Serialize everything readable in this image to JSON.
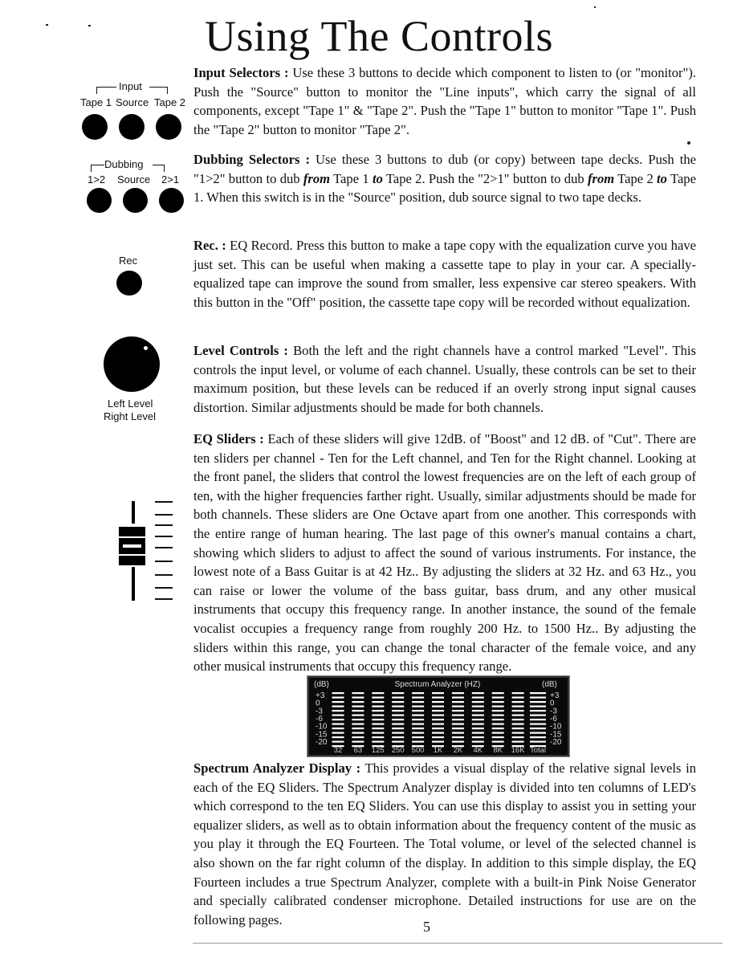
{
  "page": {
    "title": "Using The Controls",
    "page_number": "5"
  },
  "panel": {
    "input": {
      "group_label": "Input",
      "buttons": [
        "Tape 1",
        "Source",
        "Tape 2"
      ]
    },
    "dubbing": {
      "group_label": "Dubbing",
      "buttons": [
        "1>2",
        "Source",
        "2>1"
      ]
    },
    "rec": {
      "label": "Rec"
    },
    "level": {
      "labels": [
        "Left Level",
        "Right Level"
      ]
    }
  },
  "sections": {
    "input_selectors": {
      "heading": "Input Selectors :",
      "body": " Use these 3 buttons to decide which component to listen to (or \"monitor\"). Push  the \"Source\" button to monitor the \"Line inputs\", which carry the signal of all components, except \"Tape 1\" & \"Tape 2\". Push the \"Tape 1\" button to monitor \"Tape 1\". Push the \"Tape 2\" button to monitor \"Tape 2\"."
    },
    "dubbing_selectors": {
      "heading": "Dubbing Selectors :",
      "body_1": " Use these 3 buttons to dub (or copy) between tape decks. Push the \"1>2\" button to dub ",
      "em_from_1": "from",
      "body_2": " Tape 1 ",
      "em_to_1": "to",
      "body_3": " Tape 2. Push the \"2>1\" button to dub ",
      "em_from_2": "from",
      "body_4": " Tape 2 ",
      "em_to_2": "to",
      "body_5": " Tape 1. When this switch is in the \"Source\" position,  dub source signal to two tape decks."
    },
    "rec": {
      "heading": "Rec. :",
      "body": " EQ Record. Press this button to make a tape copy with the equalization curve you have just set. This can be useful when making a cassette tape to play in your car. A specially-equalized tape can improve the sound from smaller, less expensive car stereo speakers. With this button in the \"Off\" position, the cassette tape copy will be recorded without equalization."
    },
    "level_controls": {
      "heading": "Level Controls :",
      "body": " Both the left and the right channels have a control marked \"Level\". This controls the input level, or volume of each channel. Usually, these controls can be set to their maximum position, but these levels can be reduced if an overly strong input signal causes distortion. Similar adjustments should be made for both channels."
    },
    "eq_sliders": {
      "heading": "EQ Sliders :",
      "body": " Each of these sliders will give 12dB. of \"Boost\" and 12 dB. of \"Cut\". There are ten sliders per channel - Ten for the Left channel, and Ten for the Right channel. Looking at the front panel, the sliders that control the lowest frequencies are on the left of each group of ten, with the higher frequencies farther right. Usually, similar adjustments should be made for both channels. These sliders are One Octave apart from one another. This corresponds with the entire range of human hearing. The last page of this owner's manual contains a chart, showing which sliders to adjust to affect the sound of various instruments. For instance, the lowest note of a Bass Guitar is at 42 Hz.. By adjusting the sliders at 32 Hz. and 63 Hz., you can raise or lower the volume of the bass guitar, bass drum, and any other musical instruments that occupy this frequency range. In another instance, the sound of the female vocalist occupies a frequency range from roughly  200 Hz. to 1500 Hz.. By adjusting the sliders within this range, you can change the tonal character of the female voice, and any other musical instruments that occupy this frequency range."
    },
    "spectrum_analyzer": {
      "heading": "Spectrum Analyzer Display :",
      "body": " This provides a visual display of the relative signal levels in each of the EQ Sliders. The Spectrum Analyzer display is divided into ten columns of LED's which correspond to the ten EQ Sliders. You can use this display to assist you in setting your equalizer sliders, as well as to obtain information about the frequency content of the music as you play it through the EQ Fourteen. The Total volume, or level of the selected channel is also shown on the far right column of the display. In addition to this simple display, the EQ Fourteen includes a true Spectrum Analyzer, complete with a built-in Pink Noise Generator and specially calibrated condenser microphone. Detailed instructions for use are on the following pages."
    }
  },
  "analyzer_display": {
    "title": "Spectrum Analyzer (HZ)",
    "unit_left": "(dB)",
    "unit_right": "(dB)",
    "db_scale": [
      "+3",
      "0",
      "-3",
      "-6",
      "-10",
      "-15",
      "-20"
    ],
    "bands": [
      "32",
      "63",
      "125",
      "250",
      "500",
      "1K",
      "2K",
      "4K",
      "8K",
      "16K",
      "Total"
    ],
    "led_color": "#ffffff",
    "background_color": "#0a0a0a"
  }
}
